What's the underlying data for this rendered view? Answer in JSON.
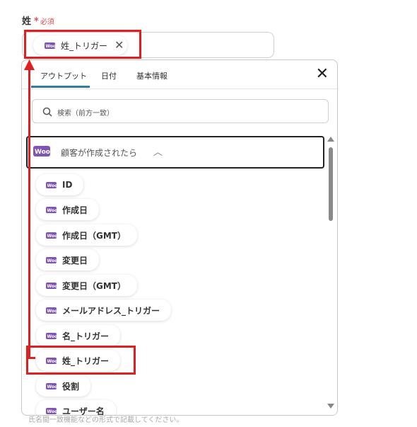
{
  "field": {
    "label": "姓",
    "required_star": "*",
    "required_text": "必須",
    "chip_label": "姓_トリガー"
  },
  "tabs": [
    "アウトプット",
    "日付",
    "基本情報"
  ],
  "search": {
    "placeholder": "検索（前方一致）"
  },
  "group": {
    "title": "顧客が作成されたら"
  },
  "items": [
    "ID",
    "作成日",
    "作成日（GMT）",
    "変更日",
    "変更日（GMT）",
    "メールアドレス_トリガー",
    "名_トリガー",
    "姓_トリガー",
    "役割",
    "ユーザー名"
  ],
  "footer_note": "氏名間一致機能などの形式で記載してください。",
  "colors": {
    "accent": "#2f7fa0",
    "woo_purple": "#7f54b3",
    "required": "#e54c4c",
    "highlight": "#e02020"
  },
  "icons": {
    "woo": "woocommerce-icon",
    "close": "close-icon",
    "search": "search-icon",
    "chevron": "chevron-up-icon"
  }
}
